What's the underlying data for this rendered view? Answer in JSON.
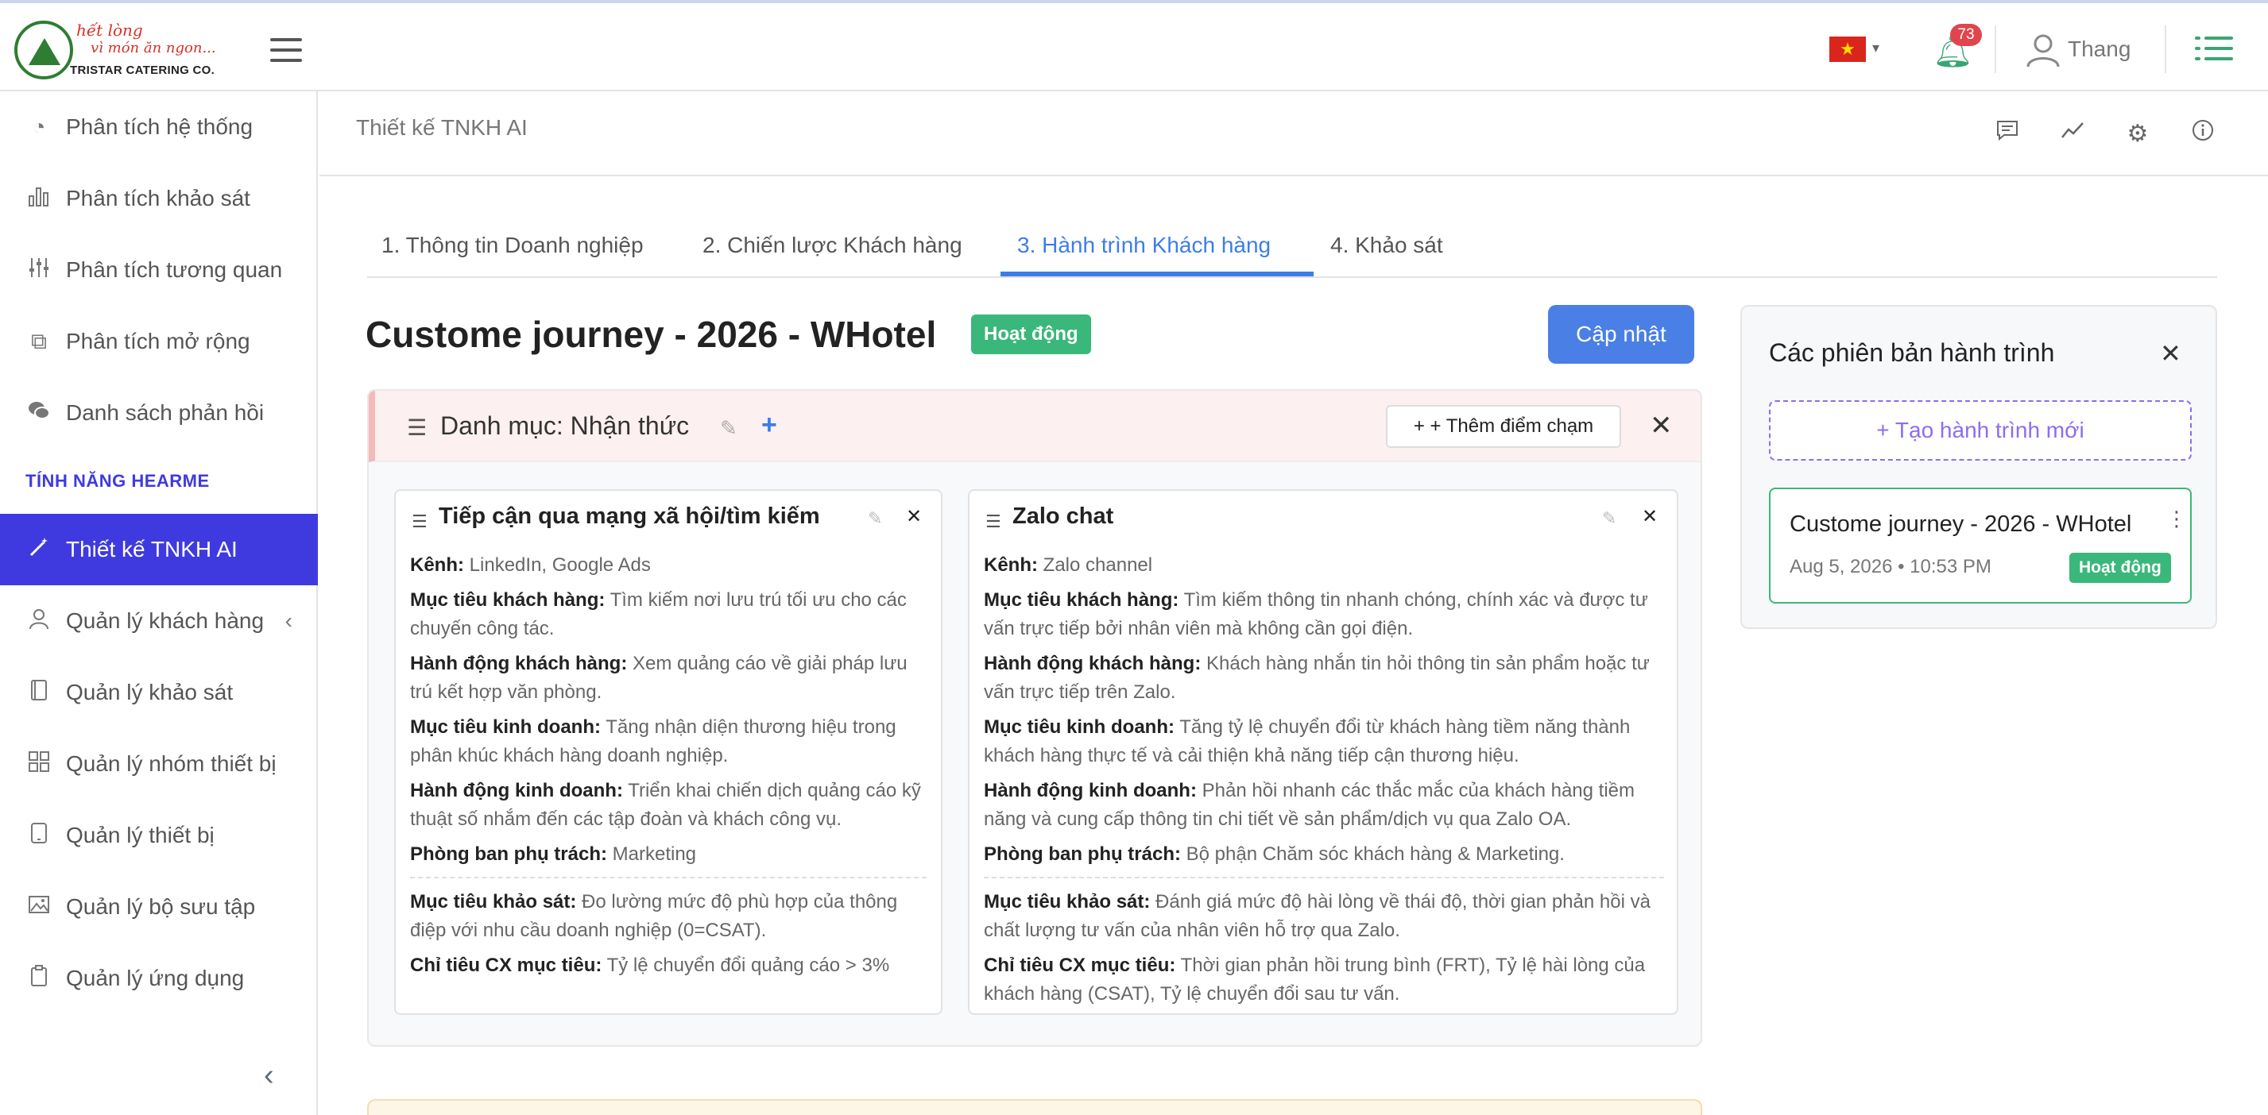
{
  "brand": {
    "tagline1": "hết lòng",
    "tagline2": "vì món ăn ngon...",
    "name": "TRISTAR CATERING CO."
  },
  "topbar": {
    "notification_count": "73",
    "user_name": "Thang",
    "flag_star": "★"
  },
  "sidebar": {
    "items": [
      {
        "label": "Phân tích hệ thống",
        "icon": "gauge-icon"
      },
      {
        "label": "Phân tích khảo sát",
        "icon": "bar-chart-icon"
      },
      {
        "label": "Phân tích tương quan",
        "icon": "sliders-icon"
      },
      {
        "label": "Phân tích mở rộng",
        "icon": "puzzle-icon"
      },
      {
        "label": "Danh sách phản hồi",
        "icon": "chat-icon"
      }
    ],
    "section_label": "TÍNH NĂNG HEARME",
    "items2": [
      {
        "label": "Thiết kế TNKH AI",
        "icon": "magic-wand-icon",
        "active": true
      },
      {
        "label": "Quản lý khách hàng",
        "icon": "user-icon"
      },
      {
        "label": "Quản lý khảo sát",
        "icon": "notebook-icon"
      },
      {
        "label": "Quản lý nhóm thiết bị",
        "icon": "grid-icon"
      },
      {
        "label": "Quản lý thiết bị",
        "icon": "tablet-icon"
      },
      {
        "label": "Quản lý bộ sưu tập",
        "icon": "image-icon"
      },
      {
        "label": "Quản lý ứng dụng",
        "icon": "clipboard-icon"
      }
    ]
  },
  "page": {
    "title": "Thiết kế TNKH AI"
  },
  "tabs": [
    {
      "label": "1. Thông tin Doanh nghiệp"
    },
    {
      "label": "2. Chiến lược Khách hàng"
    },
    {
      "label": "3. Hành trình Khách hàng",
      "active": true
    },
    {
      "label": "4. Khảo sát"
    }
  ],
  "journey": {
    "title": "Custome journey - 2026 - WHotel",
    "status": "Hoạt động",
    "update_label": "Cập nhật"
  },
  "category": {
    "title": "Danh mục: Nhận thức",
    "add_touchpoint_label": "+ + Thêm điểm chạm",
    "touchpoints": [
      {
        "title": "Tiếp cận qua mạng xã hội/tìm kiếm",
        "rows": [
          {
            "k": "Kênh:",
            "v": "LinkedIn, Google Ads"
          },
          {
            "k": "Mục tiêu khách hàng:",
            "v": "Tìm kiếm nơi lưu trú tối ưu cho các chuyến công tác."
          },
          {
            "k": "Hành động khách hàng:",
            "v": "Xem quảng cáo về giải pháp lưu trú kết hợp văn phòng."
          },
          {
            "k": "Mục tiêu kinh doanh:",
            "v": "Tăng nhận diện thương hiệu trong phân khúc khách hàng doanh nghiệp."
          },
          {
            "k": "Hành động kinh doanh:",
            "v": "Triển khai chiến dịch quảng cáo kỹ thuật số nhắm đến các tập đoàn và khách công vụ."
          },
          {
            "k": "Phòng ban phụ trách:",
            "v": "Marketing"
          }
        ],
        "rows2": [
          {
            "k": "Mục tiêu khảo sát:",
            "v": "Đo lường mức độ phù hợp của thông điệp với nhu cầu doanh nghiệp (0=CSAT)."
          },
          {
            "k": "Chỉ tiêu CX mục tiêu:",
            "v": "Tỷ lệ chuyển đổi quảng cáo > 3%"
          }
        ]
      },
      {
        "title": "Zalo chat",
        "rows": [
          {
            "k": "Kênh:",
            "v": "Zalo channel"
          },
          {
            "k": "Mục tiêu khách hàng:",
            "v": "Tìm kiếm thông tin nhanh chóng, chính xác và được tư vấn trực tiếp bởi nhân viên mà không cần gọi điện."
          },
          {
            "k": "Hành động khách hàng:",
            "v": "Khách hàng nhắn tin hỏi thông tin sản phẩm hoặc tư vấn trực tiếp trên Zalo."
          },
          {
            "k": "Mục tiêu kinh doanh:",
            "v": "Tăng tỷ lệ chuyển đổi từ khách hàng tiềm năng thành khách hàng thực tế và cải thiện khả năng tiếp cận thương hiệu."
          },
          {
            "k": "Hành động kinh doanh:",
            "v": "Phản hồi nhanh các thắc mắc của khách hàng tiềm năng và cung cấp thông tin chi tiết về sản phẩm/dịch vụ qua Zalo OA."
          },
          {
            "k": "Phòng ban phụ trách:",
            "v": "Bộ phận Chăm sóc khách hàng & Marketing."
          }
        ],
        "rows2": [
          {
            "k": "Mục tiêu khảo sát:",
            "v": "Đánh giá mức độ hài lòng về thái độ, thời gian phản hồi và chất lượng tư vấn của nhân viên hỗ trợ qua Zalo."
          },
          {
            "k": "Chỉ tiêu CX mục tiêu:",
            "v": "Thời gian phản hồi trung bình (FRT), Tỷ lệ hài lòng của khách hàng (CSAT), Tỷ lệ chuyển đổi sau tư vấn."
          }
        ]
      }
    ]
  },
  "versions": {
    "title": "Các phiên bản hành trình",
    "new_label": "+ Tạo hành trình mới",
    "items": [
      {
        "name": "Custome journey - 2026 - WHotel",
        "date": "Aug 5, 2026 • 10:53 PM",
        "status": "Hoạt động"
      }
    ]
  },
  "colors": {
    "accent": "#3d7de8",
    "active_sidebar": "#3f3ae0",
    "status_green": "#3ab77a",
    "brand_green": "#2e7d32"
  }
}
